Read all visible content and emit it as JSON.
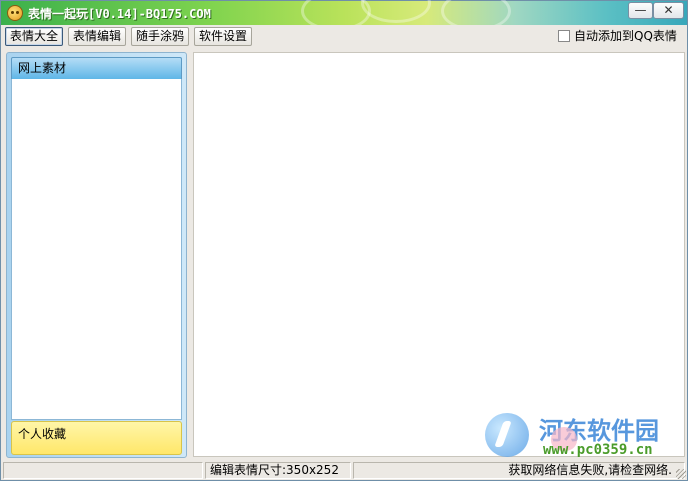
{
  "window": {
    "title": "表情一起玩[V0.14]-BQ175.COM",
    "minimize_glyph": "—",
    "close_glyph": "✕",
    "icon": "smiley-app-icon"
  },
  "toolbar": {
    "tabs": [
      {
        "label": "表情大全",
        "active": true
      },
      {
        "label": "表情编辑",
        "active": false
      },
      {
        "label": "随手涂鸦",
        "active": false
      },
      {
        "label": "软件设置",
        "active": false
      }
    ],
    "auto_add_label": "自动添加到QQ表情",
    "auto_add_checked": false
  },
  "sidebar": {
    "header": "网上素材",
    "footer": "个人收藏"
  },
  "watermark": {
    "title": "河东软件园",
    "url": "www.pc0359.cn"
  },
  "statusbar": {
    "size_text": "编辑表情尺寸:350x252",
    "status_text": "获取网络信息失败,请检查网络."
  },
  "colors": {
    "titlebar_start": "#3bb04c",
    "titlebar_end": "#38a7ba",
    "sidebar_header": "#5fb6e7",
    "sidebar_footer": "#ffe76a"
  }
}
